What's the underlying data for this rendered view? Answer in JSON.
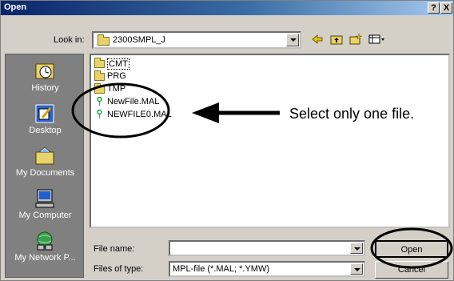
{
  "window": {
    "title": "Open",
    "help_label": "?",
    "close_label": "X"
  },
  "lookin": {
    "label": "Look in:",
    "value": "2300SMPL_J"
  },
  "toolbar": {
    "icons": [
      "back-arrow-icon",
      "up-folder-icon",
      "new-folder-icon",
      "view-menu-icon"
    ]
  },
  "places": [
    {
      "label": "History",
      "icon": "history-icon"
    },
    {
      "label": "Desktop",
      "icon": "desktop-icon"
    },
    {
      "label": "My Documents",
      "icon": "my-documents-icon"
    },
    {
      "label": "My Computer",
      "icon": "my-computer-icon"
    },
    {
      "label": "My Network P...",
      "icon": "my-network-icon"
    }
  ],
  "files": [
    {
      "name": "CMT",
      "type": "folder"
    },
    {
      "name": "PRG",
      "type": "folder"
    },
    {
      "name": "TMP",
      "type": "folder"
    },
    {
      "name": "NewFile.MAL",
      "type": "file"
    },
    {
      "name": "NEWFILE0.MAL",
      "type": "file"
    }
  ],
  "filename": {
    "label": "File name:",
    "value": ""
  },
  "filetype": {
    "label": "Files of type:",
    "value": "MPL-file (*.MAL; *.YMW)"
  },
  "buttons": {
    "open": "Open",
    "cancel": "Cancel"
  },
  "annotation": {
    "text": "Select only one file."
  },
  "colors": {
    "title_active": "#0a246a",
    "face": "#d4d0c8",
    "places_bar": "#808080"
  }
}
